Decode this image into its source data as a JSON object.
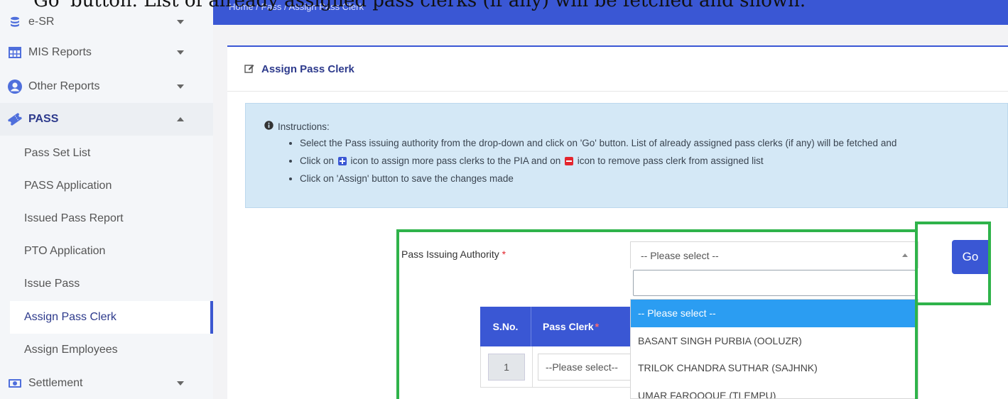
{
  "caption": "'Go' button. List of already assigned pass clerks (if any) will be fetched and shown.",
  "breadcrumb": "Home / Pass / Assign Pass Clerk",
  "sidebar": {
    "top_items": [
      {
        "label": "e-SR",
        "icon": "database-icon"
      },
      {
        "label": "MIS Reports",
        "icon": "table-icon"
      },
      {
        "label": "Other Reports",
        "icon": "user-circle-icon"
      }
    ],
    "pass_label": "PASS",
    "pass_items": [
      "Pass Set List",
      "PASS Application",
      "Issued Pass Report",
      "PTO Application",
      "Issue Pass",
      "Assign Pass Clerk",
      "Assign Employees"
    ],
    "settlement_label": "Settlement"
  },
  "card": {
    "title": "Assign Pass Clerk",
    "instructions_title": "Instructions:",
    "instr1": "Select the Pass issuing authority from the drop-down and click on 'Go' button. List of already assigned pass clerks (if any) will be fetched and",
    "instr2_pre": "Click on",
    "instr2_mid": "icon to assign more pass clerks to the PIA and on",
    "instr2_post": "icon to remove pass clerk from assigned list",
    "instr3": "Click on 'Assign' button to save the changes made"
  },
  "form": {
    "pia_label": "Pass Issuing Authority",
    "required_mark": "*",
    "selected": "-- Please select --",
    "search_value": "",
    "options": [
      "-- Please select --",
      "BASANT SINGH PURBIA (OOLUZR)",
      "TRILOK CHANDRA SUTHAR (SAJHNK)",
      "UMAR FAROOQUE (TLEMPU)"
    ],
    "go_label": "Go"
  },
  "table": {
    "col_sno": "S.No.",
    "col_clerk": "Pass Clerk",
    "rows": [
      {
        "sno": "1",
        "clerk": "--Please select--"
      }
    ]
  },
  "colors": {
    "primary": "#3a57d4",
    "highlight": "#2b9df2",
    "annotation": "#2fb34a",
    "required": "#e3262e"
  }
}
